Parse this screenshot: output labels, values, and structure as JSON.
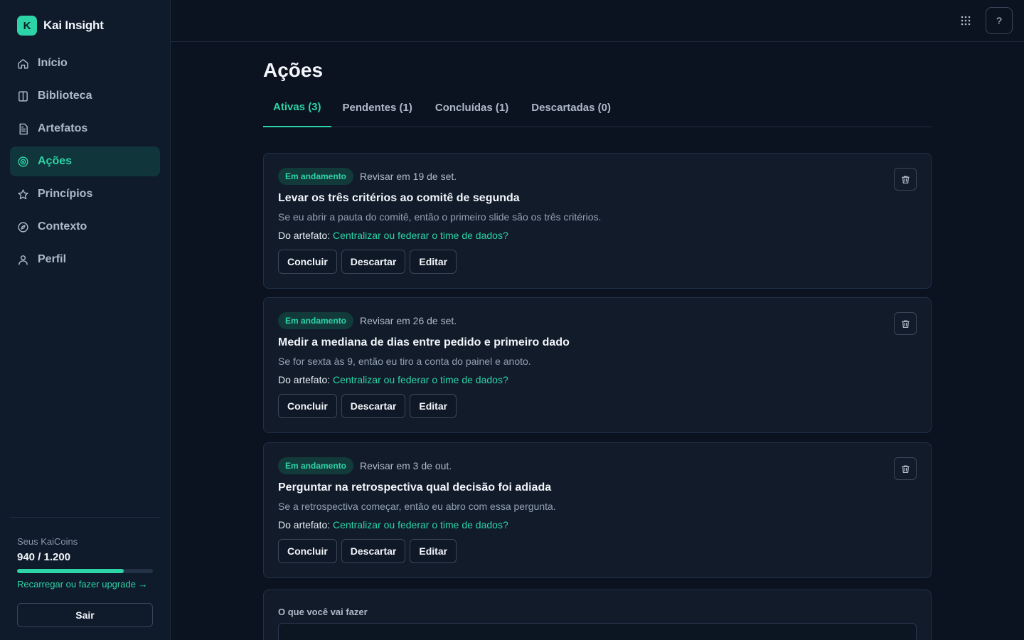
{
  "app": {
    "logo_letter": "K",
    "name": "Kai Insight"
  },
  "sidebar": {
    "items": [
      {
        "label": "Início",
        "icon": "home-icon"
      },
      {
        "label": "Biblioteca",
        "icon": "book-icon"
      },
      {
        "label": "Artefatos",
        "icon": "document-icon"
      },
      {
        "label": "Ações",
        "icon": "target-icon"
      },
      {
        "label": "Princípios",
        "icon": "star-icon"
      },
      {
        "label": "Contexto",
        "icon": "compass-icon"
      },
      {
        "label": "Perfil",
        "icon": "user-icon"
      }
    ],
    "active_index": 3,
    "coins": {
      "label": "Seus KaiCoins",
      "value": "940 / 1.200",
      "progress_fraction": 0.783,
      "link": "Recarregar ou fazer upgrade →"
    },
    "logout_label": "Sair"
  },
  "topbar": {
    "help_label": "?"
  },
  "page": {
    "title": "Ações",
    "tabs": [
      "Ativas (3)",
      "Pendentes (1)",
      "Concluídas (1)",
      "Descartadas (0)"
    ],
    "active_tab": 0
  },
  "cards": [
    {
      "status": "Em andamento",
      "review": "Revisar em 19 de set.",
      "title": "Levar os três critérios ao comitê de segunda",
      "description": "Se eu abrir a pauta do comitê, então o primeiro slide são os três critérios.",
      "source_label": "Do artefato:",
      "source_link": "Centralizar ou federar o time de dados?"
    },
    {
      "status": "Em andamento",
      "review": "Revisar em 26 de set.",
      "title": "Medir a mediana de dias entre pedido e primeiro dado",
      "description": "Se for sexta às 9, então eu tiro a conta do painel e anoto.",
      "source_label": "Do artefato:",
      "source_link": "Centralizar ou federar o time de dados?"
    },
    {
      "status": "Em andamento",
      "review": "Revisar em 3 de out.",
      "title": "Perguntar na retrospectiva qual decisão foi adiada",
      "description": "Se a retrospectiva começar, então eu abro com essa pergunta.",
      "source_label": "Do artefato:",
      "source_link": "Centralizar ou federar o time de dados?"
    }
  ],
  "card_actions": {
    "complete": "Concluir",
    "discard": "Descartar",
    "edit": "Editar"
  },
  "new_action": {
    "label": "O que você vai fazer",
    "value": ""
  },
  "colors": {
    "accent": "#2dd4a7",
    "background": "#0b1220",
    "sidebar": "#0f1a2b",
    "card": "#111b2a"
  }
}
